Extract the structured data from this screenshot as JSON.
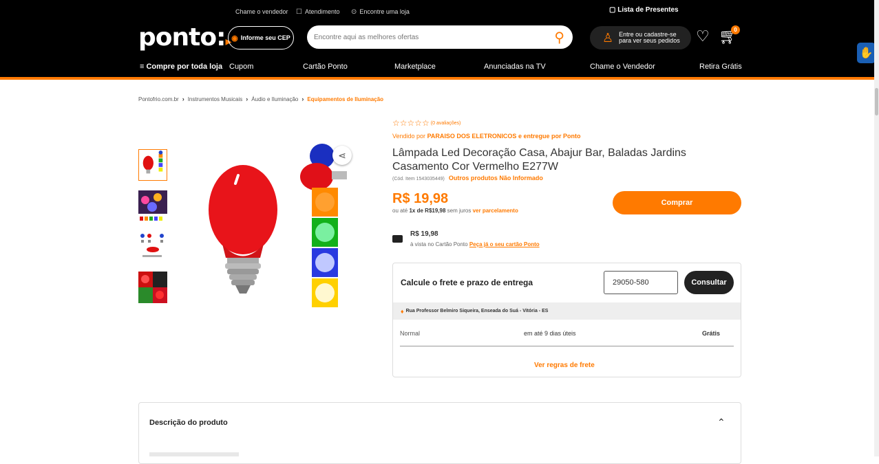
{
  "utility": {
    "chame_vendedor": "Chame o vendedor",
    "atendimento": "Atendimento",
    "encontre_loja": "Encontre uma loja",
    "lista_presentes": "Lista de Presentes"
  },
  "header": {
    "logo": "ponto:",
    "cep_button": "Informe seu CEP",
    "search_placeholder": "Encontre aqui as melhores ofertas",
    "login_line1": "Entre ou cadastre-se",
    "login_line2": "para ver seus pedidos",
    "cart_count": "0"
  },
  "nav": {
    "compre": "Compre por toda loja",
    "items": [
      "Cupom",
      "Cartão Ponto",
      "Marketplace",
      "Anunciadas na TV",
      "Chame o Vendedor",
      "Retira Grátis"
    ]
  },
  "breadcrumb": [
    "Pontofrio.com.br",
    "Instrumentos Musicais",
    "Áudio e Iluminação",
    "Equipamentos de Iluminação"
  ],
  "product": {
    "reviews": "(0 avaliações)",
    "sold_by_prefix": "Vendido por",
    "seller": "PARAISO DOS ELETRONICOS",
    "delivered_by": "e entregue por Ponto",
    "title": "Lâmpada Led Decoração Casa, Abajur Bar, Baladas Jardins Casamento Cor Vermelho E277W",
    "code": "(Cód. Item 1543035449)",
    "other_products": "Outros produtos Não Informado",
    "price": "R$ 19,98",
    "installment_prefix": "ou até",
    "installment_bold": "1x de R$19,98",
    "installment_suffix": "sem juros",
    "installment_link": "ver parcelamento",
    "buy_label": "Comprar",
    "card_price": "R$ 19,98",
    "card_sub": "à vista no Cartão Ponto",
    "card_link": "Peça já o seu cartão Ponto"
  },
  "shipping": {
    "title": "Calcule o frete e prazo de entrega",
    "cep_value": "29050-580",
    "consult_label": "Consultar",
    "address": "Rua Professor Belmiro Siqueira, Enseada do Suá - Vitória - ES",
    "option_name": "Normal",
    "option_time": "em até 9 dias úteis",
    "option_price": "Grátis",
    "rules_link": "Ver regras de frete"
  },
  "description": {
    "title": "Descrição do produto"
  },
  "colors": {
    "accent": "#ff7a00",
    "header_bg": "#000000"
  }
}
